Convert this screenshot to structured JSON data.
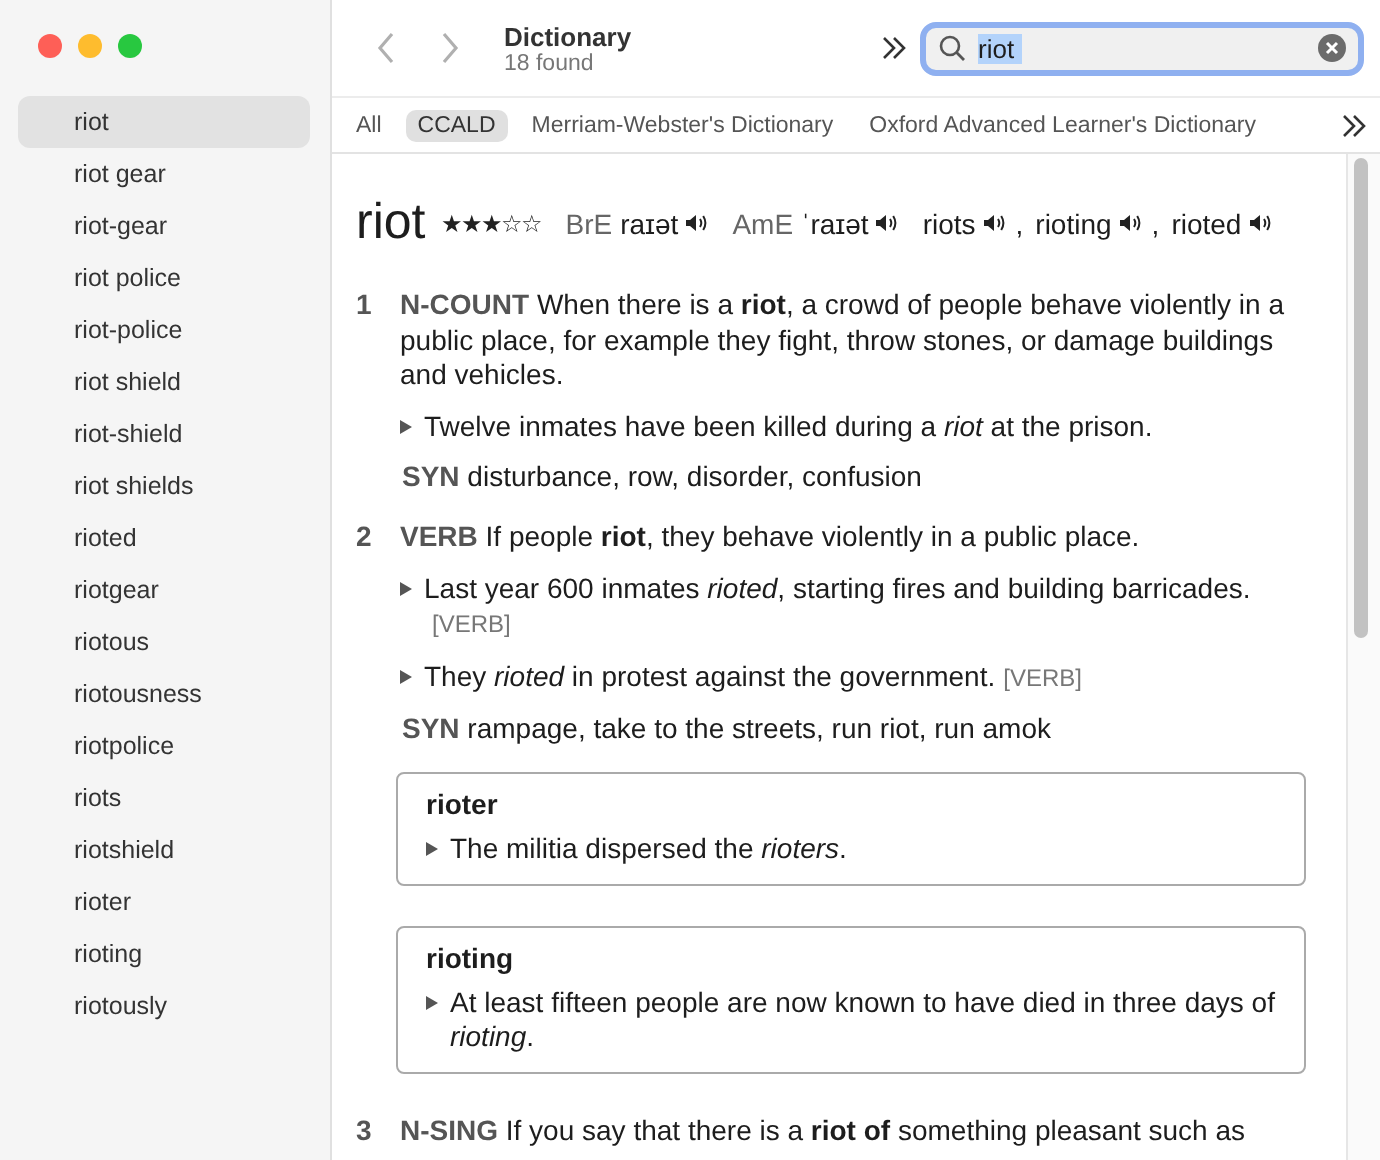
{
  "sidebar": {
    "items": [
      {
        "label": "riot",
        "selected": true
      },
      {
        "label": "riot gear",
        "selected": false
      },
      {
        "label": "riot-gear",
        "selected": false
      },
      {
        "label": "riot police",
        "selected": false
      },
      {
        "label": "riot-police",
        "selected": false
      },
      {
        "label": "riot shield",
        "selected": false
      },
      {
        "label": "riot-shield",
        "selected": false
      },
      {
        "label": "riot shields",
        "selected": false
      },
      {
        "label": "rioted",
        "selected": false
      },
      {
        "label": "riotgear",
        "selected": false
      },
      {
        "label": "riotous",
        "selected": false
      },
      {
        "label": "riotousness",
        "selected": false
      },
      {
        "label": "riotpolice",
        "selected": false
      },
      {
        "label": "riots",
        "selected": false
      },
      {
        "label": "riotshield",
        "selected": false
      },
      {
        "label": "rioter",
        "selected": false
      },
      {
        "label": "rioting",
        "selected": false
      },
      {
        "label": "riotously",
        "selected": false
      }
    ]
  },
  "toolbar": {
    "title": "Dictionary",
    "subtitle": "18 found",
    "search": {
      "value": "riot"
    }
  },
  "sources": [
    {
      "label": "All",
      "selected": false
    },
    {
      "label": "CCALD",
      "selected": true
    },
    {
      "label": "Merriam-Webster's Dictionary",
      "selected": false
    },
    {
      "label": "Oxford Advanced Learner's Dictionary",
      "selected": false
    }
  ],
  "entry": {
    "headword": "riot",
    "stars": 3,
    "pronunciations": [
      {
        "region": "BrE",
        "ipa": "raɪət"
      },
      {
        "region": "AmE",
        "ipa": "ˈraɪət"
      }
    ],
    "forms": [
      {
        "text": "riots",
        "separator": ","
      },
      {
        "text": "rioting",
        "separator": ","
      },
      {
        "text": "rioted"
      }
    ],
    "sections": [
      {
        "kind": "sense",
        "number": "1",
        "pos": "N-COUNT",
        "definition": "When there is a **riot**, a crowd of people behave violently in a public place, for example they fight, throw stones, or damage buildings and vehicles.",
        "examples": [
          {
            "text": "Twelve inmates have been killed during a *riot* at the prison."
          }
        ],
        "syn": {
          "label": "SYN",
          "text": "disturbance, row, disorder, confusion"
        }
      },
      {
        "kind": "sense",
        "number": "2",
        "pos": "VERB",
        "definition": "If people **riot**, they behave violently in a public place.",
        "examples": [
          {
            "text": "Last year 600 inmates *rioted*, starting fires and building barricades.",
            "tag": "[VERB]"
          },
          {
            "text": "They *rioted* in protest against the government.",
            "tag": "[VERB]"
          }
        ],
        "syn": {
          "label": "SYN",
          "text": "rampage, take to the streets, run riot, run amok"
        }
      },
      {
        "kind": "derived",
        "word": "rioter",
        "examples": [
          {
            "text": "The militia dispersed the *rioters*."
          }
        ]
      },
      {
        "kind": "derived",
        "word": "rioting",
        "examples": [
          {
            "text": "At least fifteen people are now known to have died in three days of *rioting*."
          }
        ]
      },
      {
        "kind": "sense",
        "number": "3",
        "pos": "N-SING",
        "definition": "If you say that there is a **riot of** something pleasant such as"
      }
    ]
  }
}
